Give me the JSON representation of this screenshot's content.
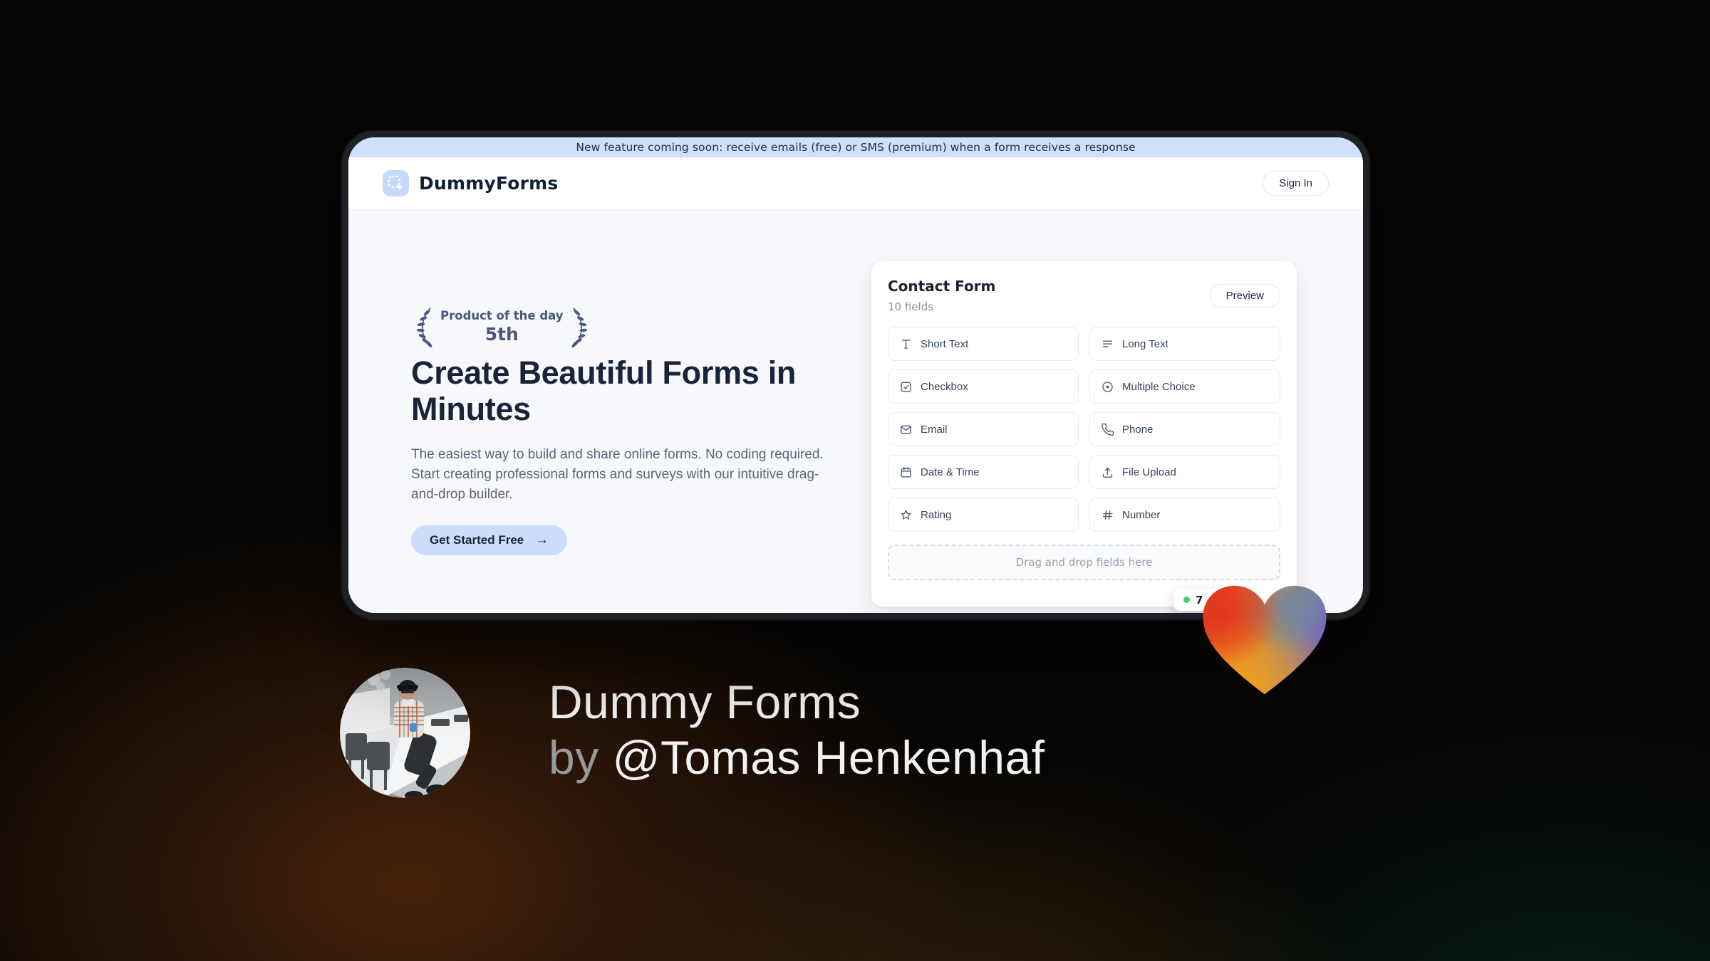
{
  "banner": {
    "text": "New feature coming soon: receive emails (free) or SMS (premium) when a form receives a response"
  },
  "header": {
    "brand": "DummyForms",
    "sign_in_label": "Sign In"
  },
  "hero": {
    "badge": {
      "line1": "Product of the day",
      "line2": "5th"
    },
    "heading": "Create Beautiful Forms in Minutes",
    "description": "The easiest way to build and share online forms. No coding required. Start creating professional forms and surveys with our intuitive drag-and-drop builder.",
    "cta_label": "Get Started Free",
    "cta_arrow": "→"
  },
  "form_builder": {
    "title": "Contact Form",
    "subtitle": "10 fields",
    "preview_label": "Preview",
    "fields": [
      {
        "label": "Short Text",
        "icon": "short-text-icon"
      },
      {
        "label": "Long Text",
        "icon": "long-text-icon"
      },
      {
        "label": "Checkbox",
        "icon": "checkbox-icon"
      },
      {
        "label": "Multiple Choice",
        "icon": "radio-icon"
      },
      {
        "label": "Email",
        "icon": "email-icon"
      },
      {
        "label": "Phone",
        "icon": "phone-icon"
      },
      {
        "label": "Date & Time",
        "icon": "calendar-icon"
      },
      {
        "label": "File Upload",
        "icon": "upload-icon"
      },
      {
        "label": "Rating",
        "icon": "star-icon"
      },
      {
        "label": "Number",
        "icon": "hash-icon"
      }
    ],
    "dropzone_text": "Drag and drop fields here",
    "status_badge": {
      "visible_text": "7",
      "dot_color": "#43d168"
    }
  },
  "author": {
    "product_name": "Dummy Forms",
    "by_label": "by ",
    "handle": "@Tomas Henkenhaf"
  },
  "colors": {
    "banner_bg": "#cfe0fa",
    "accent_blue": "#cbddf9",
    "logo_blue": "#c7d9f8",
    "laurel_slate": "#49587c",
    "heading_navy": "#19233a",
    "heart_red": "#e23a1f",
    "heart_orange": "#f0991e",
    "heart_slate": "#74859f",
    "heart_purple": "#7a5ac7",
    "page_bg": "#060504"
  }
}
